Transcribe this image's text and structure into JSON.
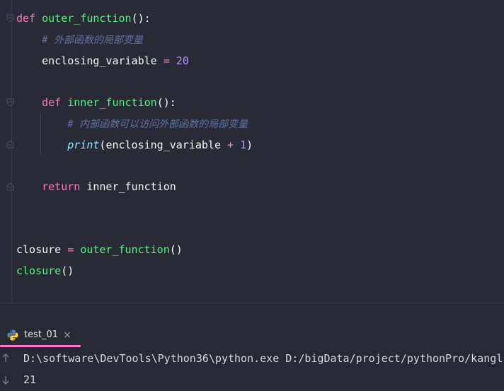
{
  "editor": {
    "lines": {
      "l1": {
        "kw": "def",
        "name": "outer_function",
        "punct": "():"
      },
      "l2": {
        "comment": "# 外部函数的局部变量"
      },
      "l3": {
        "var": "enclosing_variable",
        "op": "=",
        "num": "20"
      },
      "l5": {
        "kw": "def",
        "name": "inner_function",
        "punct": "():"
      },
      "l6": {
        "comment": "# 内部函数可以访问外部函数的局部变量"
      },
      "l7": {
        "builtin": "print",
        "open": "(",
        "var": "enclosing_variable",
        "op": "+",
        "num": "1",
        "close": ")"
      },
      "l9": {
        "kw": "return",
        "var": "inner_function"
      },
      "l12": {
        "var": "closure",
        "op": "=",
        "call": "outer_function",
        "punct": "()"
      },
      "l13": {
        "call": "closure",
        "punct": "()"
      }
    }
  },
  "run_panel": {
    "tab": {
      "label": "test_01",
      "close_glyph": "×",
      "icon": "python-icon"
    },
    "console": {
      "command": "D:\\software\\DevTools\\Python36\\python.exe D:/bigData/project/pythonPro/kangl",
      "output": "21"
    },
    "side_icons": [
      "arrow-up-icon",
      "arrow-down-icon"
    ]
  },
  "colors": {
    "background": "#282a36",
    "keyword": "#ff79c6",
    "function": "#50fa7b",
    "number": "#bd93f9",
    "comment": "#6272a4",
    "builtin": "#8be9fd",
    "tab_underline": "#ff79c6"
  }
}
